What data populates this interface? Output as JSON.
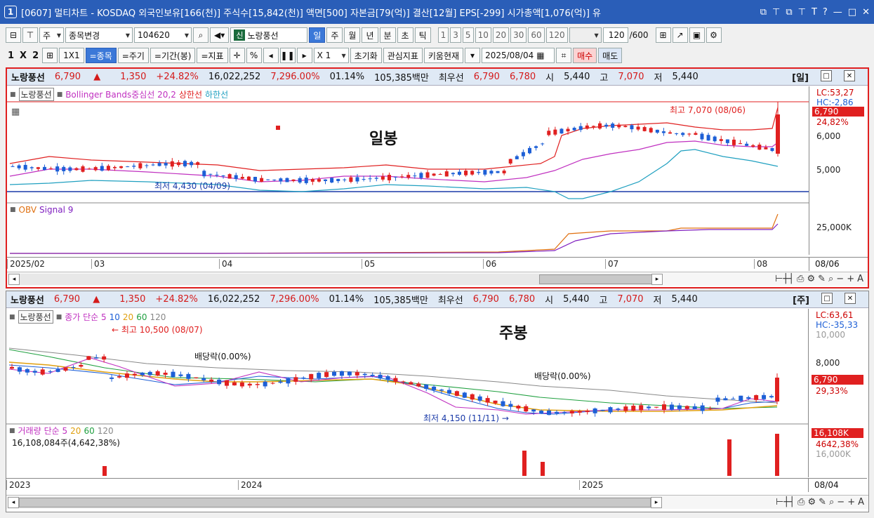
{
  "window": {
    "number": "1",
    "title": "[0607] 멀티차트 - KOSDAQ 외국인보유[166(천)] 주식수[15,842(천)] 액면[500] 자본금[79(억)] 결산[12월] EPS[-299] 시가총액[1,076(억)] 유",
    "buttons": [
      "⧉",
      "⊤",
      "⧉",
      "⊤",
      "T",
      "?",
      "—",
      "□",
      "✕"
    ]
  },
  "toolbar1": {
    "mode": "주",
    "change_label": "종목변경",
    "code": "104620",
    "stock_badge": "신",
    "stock_name": "노랑풍선",
    "periods": [
      "일",
      "주",
      "월",
      "년",
      "분",
      "초",
      "틱"
    ],
    "active_period": "일",
    "numbers": [
      "1",
      "3",
      "5",
      "10",
      "20",
      "30",
      "60",
      "120"
    ],
    "count": "120",
    "total": "/600"
  },
  "toolbar2": {
    "layout_labels": [
      "1",
      "X",
      "2"
    ],
    "btn_1x1": "1X1",
    "btn_stock": "=종목",
    "btn_period": "=주기",
    "btn_range": "=기간(봉)",
    "btn_indicator": "=지표",
    "percent": "%",
    "multiplier": "X 1",
    "btn_reset": "초기화",
    "btn_watch": "관심지표",
    "btn_kiwoom": "키움현재",
    "date": "2025/08/04",
    "btn_buy": "매수",
    "btn_sell": "매도"
  },
  "panel_daily": {
    "header": {
      "name": "노랑풍선",
      "price": "6,790",
      "arrow": "▲",
      "change": "1,350",
      "change_pct": "+24.82%",
      "volume": "16,022,252",
      "vol_pct": "7,296.00%",
      "turnover": "01.14%",
      "amount": "105,385백만",
      "best_label": "최우선",
      "ask": "6,790",
      "bid": "6,780",
      "open_label": "시",
      "open": "5,440",
      "high_label": "고",
      "high": "7,070",
      "low_label": "저",
      "low": "5,440",
      "period": "[일]"
    },
    "legend": {
      "chip": "노랑풍선",
      "bb": "Bollinger Bands중심선 20,2",
      "upper": "상한선",
      "lower": "하한선"
    },
    "overlay_title": "일봉",
    "ann_high": "최고 7,070 (08/06)",
    "ann_low": "최저 4,430 (04/09)",
    "yaxis": {
      "lc": "LC:53,27",
      "hc": "HC:-2,86",
      "price_tag": "6,790",
      "pct_tag": "24,82%",
      "t1": "6,000",
      "t2": "5,000"
    },
    "sub_legend": {
      "obv": "OBV",
      "signal": "Signal 9"
    },
    "sub_y": "25,000K",
    "xlabels": [
      "2025/02",
      "03",
      "04",
      "05",
      "06",
      "07",
      "08"
    ],
    "xright": "08/06"
  },
  "panel_weekly": {
    "header": {
      "name": "노랑풍선",
      "price": "6,790",
      "arrow": "▲",
      "change": "1,350",
      "change_pct": "+24.82%",
      "volume": "16,022,252",
      "vol_pct": "7,296.00%",
      "turnover": "01.14%",
      "amount": "105,385백만",
      "best_label": "최우선",
      "ask": "6,790",
      "bid": "6,780",
      "open_label": "시",
      "open": "5,440",
      "high_label": "고",
      "high": "7,070",
      "low_label": "저",
      "low": "5,440",
      "period": "[주]"
    },
    "legend": {
      "chip": "노랑풍선",
      "ma": "종가 단순 5",
      "p10": "10",
      "p20": "20",
      "p60": "60",
      "p120": "120"
    },
    "overlay_title": "주봉",
    "ann_high": "최고 10,500 (08/07)",
    "ann_div1": "배당락(0.00%)",
    "ann_div2": "배당락(0.00%)",
    "ann_low": "최저 4,150 (11/11)",
    "yaxis": {
      "lc": "LC:63,61",
      "hc": "HC:-35,33",
      "t0": "10,000",
      "t1": "8,000",
      "price_tag": "6,790",
      "pct_tag": "29,33%"
    },
    "sub_legend": {
      "vol": "거래량",
      "ma": "단순 5",
      "p20": "20",
      "p60": "60",
      "p120": "120",
      "vol_text": "16,108,084주(4,642,38%)"
    },
    "sub_y": {
      "tag": "16,108K",
      "pct": "4642,38%",
      "tick": "16,000K"
    },
    "xlabels": [
      "2023",
      "2024",
      "2025"
    ],
    "xright": "08/04"
  },
  "colors": {
    "up": "#e02020",
    "down": "#1d5fd6",
    "bb_upper": "#e02020",
    "bb_mid": "#c030c0",
    "bb_lower": "#20a0c0",
    "obv": "#e07010",
    "signal": "#8020c0"
  },
  "chart_data": [
    {
      "type": "candlestick",
      "title": "일봉",
      "period": "daily",
      "last_close": 6790,
      "high": 7070,
      "low": 4430,
      "x": [
        "2025/02",
        "03",
        "04",
        "05",
        "06",
        "07",
        "08"
      ]
    },
    {
      "type": "candlestick",
      "title": "주봉",
      "period": "weekly",
      "last_close": 6790,
      "high": 10500,
      "low": 4150,
      "x": [
        "2023",
        "2024",
        "2025"
      ]
    }
  ]
}
